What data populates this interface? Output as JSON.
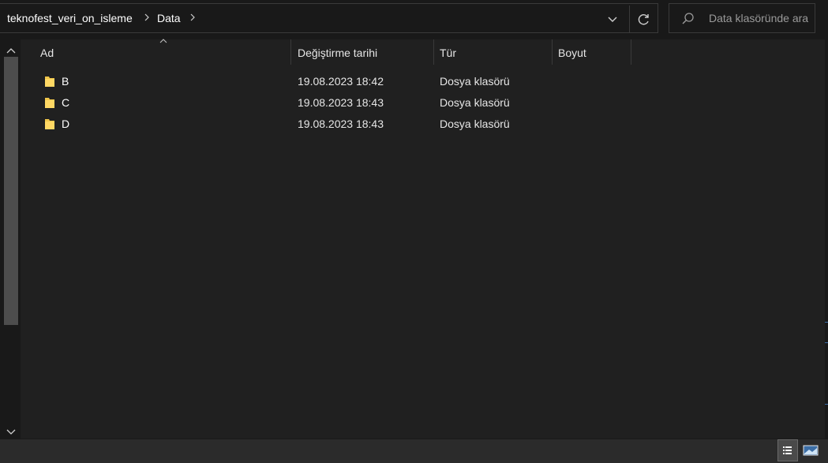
{
  "address": {
    "breadcrumbs": [
      "teknofest_veri_on_isleme",
      "Data"
    ]
  },
  "search": {
    "placeholder": "Data klasöründe ara"
  },
  "columns": {
    "name": "Ad",
    "date": "Değiştirme tarihi",
    "type": "Tür",
    "size": "Boyut"
  },
  "files": [
    {
      "name": "B",
      "date": "19.08.2023 18:42",
      "type": "Dosya klasörü",
      "size": ""
    },
    {
      "name": "C",
      "date": "19.08.2023 18:43",
      "type": "Dosya klasörü",
      "size": ""
    },
    {
      "name": "D",
      "date": "19.08.2023 18:43",
      "type": "Dosya klasörü",
      "size": ""
    }
  ],
  "icons": {
    "folder": "folder-icon",
    "refresh": "refresh-icon",
    "search": "search-icon",
    "dropdown": "chevron-down-icon",
    "separator": "chevron-right-icon"
  },
  "colors": {
    "folder": "#f0c64a",
    "background": "#202020",
    "accent": "#3c6ea6"
  }
}
